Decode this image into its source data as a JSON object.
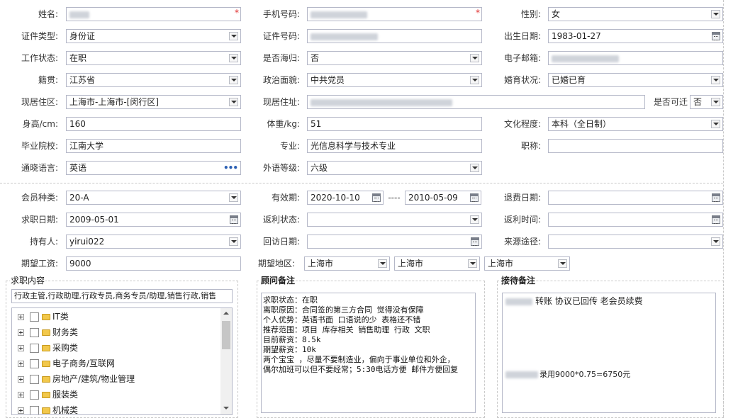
{
  "form": {
    "name_label": "姓名:",
    "phone_label": "手机号码:",
    "gender_label": "性别:",
    "gender_value": "女",
    "idtype_label": "证件类型:",
    "idtype_value": "身份证",
    "idno_label": "证件号码:",
    "birth_label": "出生日期:",
    "birth_value": "1983-01-27",
    "workstatus_label": "工作状态:",
    "workstatus_value": "在职",
    "overseas_label": "是否海归:",
    "overseas_value": "否",
    "email_label": "电子邮箱:",
    "native_label": "籍贯:",
    "native_value": "江苏省",
    "political_label": "政治面貌:",
    "political_value": "中共党员",
    "marital_label": "婚育状况:",
    "marital_value": "已婚已育",
    "area_label": "现居住区:",
    "area_value": "上海市-上海市-[闵行区]",
    "address_label": "现居住址:",
    "relocate_label": "是否可迁",
    "relocate_value": "否",
    "height_label": "身高/cm:",
    "height_value": "160",
    "weight_label": "体重/kg:",
    "weight_value": "51",
    "education_label": "文化程度:",
    "education_value": "本科（全日制）",
    "school_label": "毕业院校:",
    "school_value": "江南大学",
    "major_label": "专业:",
    "major_value": "光信息科学与技术专业",
    "title_label": "职称:",
    "language_label": "通晓语言:",
    "language_value": "英语",
    "language_level_label": "外语等级:",
    "language_level_value": "六级"
  },
  "member": {
    "type_label": "会员种类:",
    "type_value": "20-A",
    "valid_label": "有效期:",
    "valid_from": "2020-10-10",
    "valid_sep": "----",
    "valid_to": "2010-05-09",
    "refund_date_label": "退费日期:",
    "job_date_label": "求职日期:",
    "job_date_value": "2009-05-01",
    "rebate_status_label": "返利状态:",
    "rebate_time_label": "返利时间:",
    "holder_label": "持有人:",
    "holder_value": "yirui022",
    "visit_date_label": "回访日期:",
    "source_label": "来源途径:",
    "salary_label": "期望工资:",
    "salary_value": "9000",
    "region_label": "期望地区:",
    "region1": "上海市",
    "region2": "上海市",
    "region3": "上海市"
  },
  "job_content": {
    "title": "求职内容",
    "selected_text": "行政主管,行政助理,行政专员,商务专员/助理,销售行政,销售",
    "tree": [
      "IT类",
      "财务类",
      "采购类",
      "电子商务/互联网",
      "房地产/建筑/物业管理",
      "服装类",
      "机械类"
    ]
  },
  "advisor_notes": {
    "title": "顾问备注",
    "lines": [
      "求职状态：在职",
      "离职原因：合同签的第三方合同 觉得没有保障",
      "个人优势：英语书面  口语说的少 表格还不错",
      "推荐范围：项目  库存相关 销售助理 行政 文职",
      "目前薪资：8.5k",
      "期望薪资：10k",
      "两个宝宝 ，尽量不要制造业，偏向于事业单位和外企，",
      "偶尔加班可以但不要经常；5:30电话方便 邮件方便回复"
    ]
  },
  "reception_notes": {
    "title": "接待备注",
    "line1": "转账 协议已回传 老会员续费",
    "line2": "录用9000*0.75=6750元"
  },
  "colors": {
    "required": "#e03030",
    "border": "#b5b8c8",
    "dots": "#2b5fb3"
  }
}
